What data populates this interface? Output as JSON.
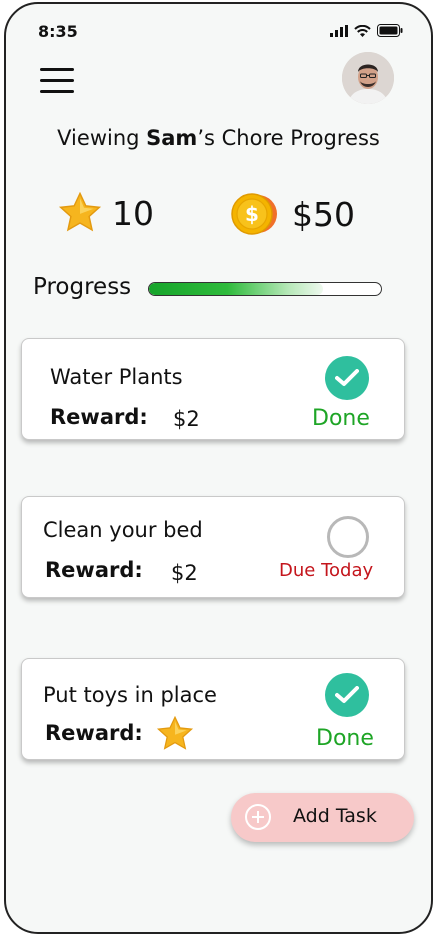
{
  "status_bar": {
    "time": "8:35"
  },
  "header": {
    "title_prefix": "Viewing ",
    "child_name": "Sam",
    "title_suffix": "’s Chore Progress"
  },
  "stats": {
    "stars": "10",
    "money": "$50"
  },
  "progress": {
    "label": "Progress",
    "fraction": 0.75
  },
  "tasks": [
    {
      "title": "Water Plants",
      "reward_label": "Reward:",
      "reward": "$2",
      "status": "Done",
      "status_color": "#1ea526"
    },
    {
      "title": "Clean your bed",
      "reward_label": "Reward:",
      "reward": "$2",
      "status": "Due Today",
      "status_color": "#c4151c"
    },
    {
      "title": "Put toys in place",
      "reward_label": "Reward:",
      "reward_icon": "star-icon",
      "status": "Done",
      "status_color": "#1ea526"
    }
  ],
  "add_task": {
    "label": "Add Task"
  },
  "colors": {
    "check": "#2fbf9e",
    "add_button": "#f7c9c9",
    "progress_start": "#16a42a"
  }
}
